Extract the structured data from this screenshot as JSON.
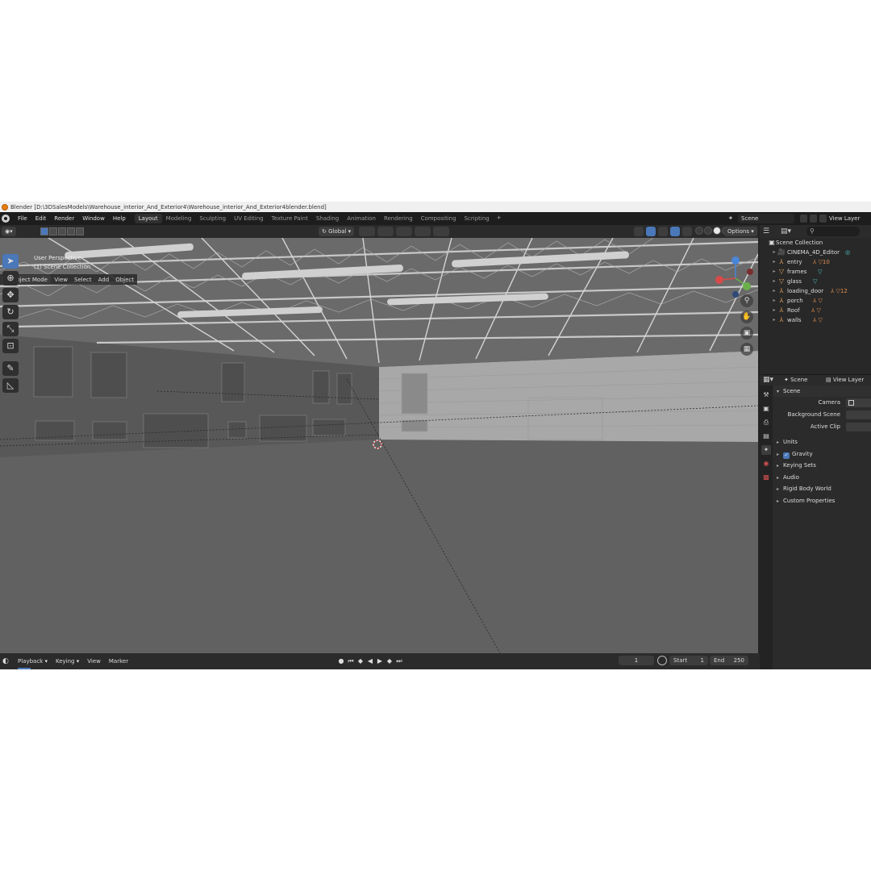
{
  "window": {
    "title": "Blender [D:\\3DSalesModels\\Warehouse_interior_And_Exterior4\\Warehouse_interior_And_Exterior4blender.blend]"
  },
  "menu": {
    "items": [
      "File",
      "Edit",
      "Render",
      "Window",
      "Help"
    ]
  },
  "workspaces": [
    "Layout",
    "Modeling",
    "Sculpting",
    "UV Editing",
    "Texture Paint",
    "Shading",
    "Animation",
    "Rendering",
    "Compositing",
    "Scripting"
  ],
  "active_workspace": "Layout",
  "scene_selector": {
    "value": "Scene"
  },
  "view_layer_selector": {
    "value": "View Layer"
  },
  "viewport": {
    "mode": "Object Mode",
    "header_menus": [
      "View",
      "Select",
      "Add",
      "Object"
    ],
    "transform_orientation": "Global",
    "options_label": "Options",
    "overlay_line1": "User Perspective",
    "overlay_line2": "(1) Scene Collection"
  },
  "outliner": {
    "search_icon": "search-icon",
    "root": "Scene Collection",
    "items": [
      {
        "name": "CINEMA_4D_Editor",
        "icon": "camera-icon",
        "extra": ""
      },
      {
        "name": "entry",
        "icon": "empty-icon",
        "extra": "10"
      },
      {
        "name": "frames",
        "icon": "mesh-icon",
        "extra": ""
      },
      {
        "name": "glass",
        "icon": "mesh-icon",
        "extra": ""
      },
      {
        "name": "loading_door",
        "icon": "empty-icon",
        "extra": "12"
      },
      {
        "name": "porch",
        "icon": "empty-icon",
        "extra": ""
      },
      {
        "name": "Roof",
        "icon": "empty-icon",
        "extra": ""
      },
      {
        "name": "walls",
        "icon": "empty-icon",
        "extra": ""
      }
    ]
  },
  "properties": {
    "header_scene": "Scene",
    "header_view_layer": "View Layer",
    "panel_title": "Scene",
    "rows": [
      {
        "label": "Camera"
      },
      {
        "label": "Background Scene"
      },
      {
        "label": "Active Clip"
      }
    ],
    "subpanels": [
      "Units",
      "Gravity",
      "Keying Sets",
      "Audio",
      "Rigid Body World",
      "Custom Properties"
    ],
    "gravity_checked": true
  },
  "timeline": {
    "menus": [
      "Playback",
      "Keying",
      "View",
      "Marker"
    ],
    "current_frame": "1",
    "start_label": "Start",
    "start_value": "1",
    "end_label": "End",
    "end_value": "250"
  },
  "colors": {
    "accent": "#4a78b8",
    "background": "#232323",
    "viewport": "#5e5e5e",
    "header": "#2b2b2b"
  }
}
